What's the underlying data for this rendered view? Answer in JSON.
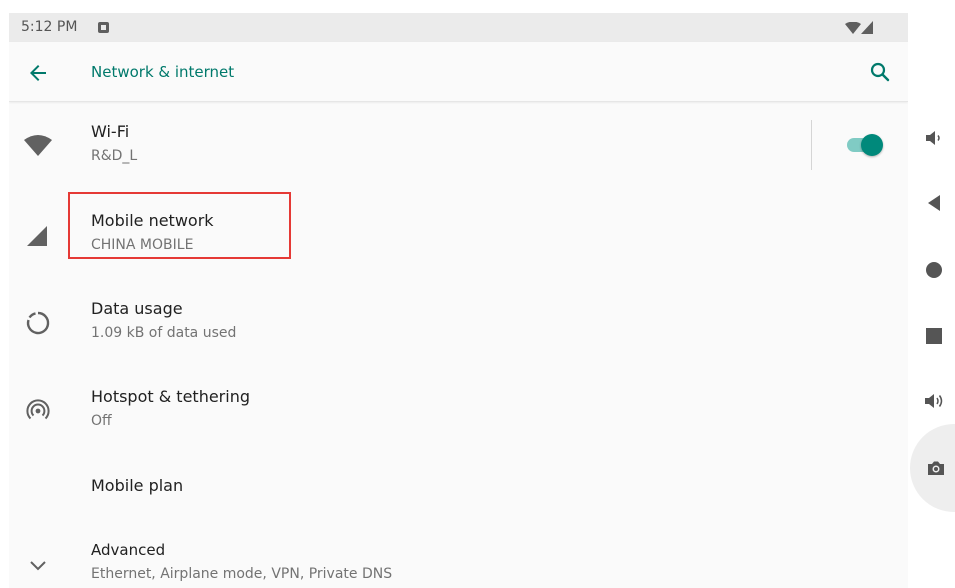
{
  "status_bar": {
    "time": "5:12 PM"
  },
  "app_bar": {
    "title": "Network & internet"
  },
  "rows": [
    {
      "title": "Wi-Fi",
      "subtitle": "R&D_L",
      "toggle_on": true
    },
    {
      "title": "Mobile network",
      "subtitle": "CHINA MOBILE"
    },
    {
      "title": "Data usage",
      "subtitle": "1.09 kB of data used"
    },
    {
      "title": "Hotspot & tethering",
      "subtitle": "Off"
    },
    {
      "title": "Mobile plan"
    },
    {
      "title": "Advanced",
      "subtitle": "Ethernet, Airplane mode, VPN, Private DNS"
    }
  ],
  "colors": {
    "accent": "#00796b",
    "toggle_thumb": "#00897b",
    "toggle_track": "#80cbc4",
    "highlight": "#e53935"
  },
  "icons": [
    "back-arrow-icon",
    "search-icon",
    "wifi-icon",
    "signal-icon",
    "data-usage-icon",
    "hotspot-icon",
    "chevron-down-icon",
    "volume-down-icon",
    "back-triangle-icon",
    "home-circle-icon",
    "recents-square-icon",
    "volume-up-icon",
    "camera-icon"
  ]
}
